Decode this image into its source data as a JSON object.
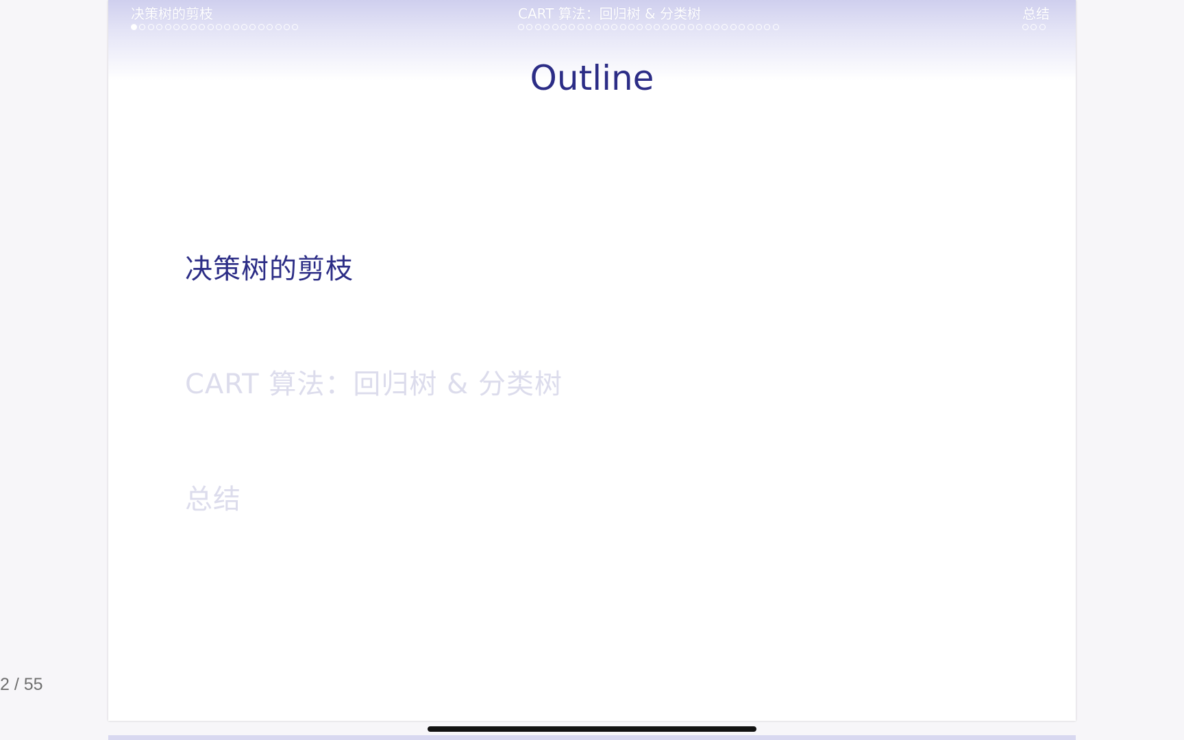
{
  "nav": {
    "sections": [
      {
        "title": "决策树的剪枝",
        "dots": 20,
        "current": 0
      },
      {
        "title": "CART 算法：回归树 & 分类树",
        "dots": 31,
        "current": -1
      },
      {
        "title": "总结",
        "dots": 3,
        "current": -1
      }
    ]
  },
  "frame": {
    "title": "Outline"
  },
  "toc": {
    "items": [
      {
        "label": "决策树的剪枝",
        "active": true
      },
      {
        "label": "CART 算法：回归树 & 分类树",
        "active": false
      },
      {
        "label": "总结",
        "active": false
      }
    ]
  },
  "viewer": {
    "page_counter": "2 / 55"
  },
  "colors": {
    "accent": "#2c2d86",
    "inactive": "#dcdcec",
    "header_gradient_top": "#cfcfee"
  }
}
